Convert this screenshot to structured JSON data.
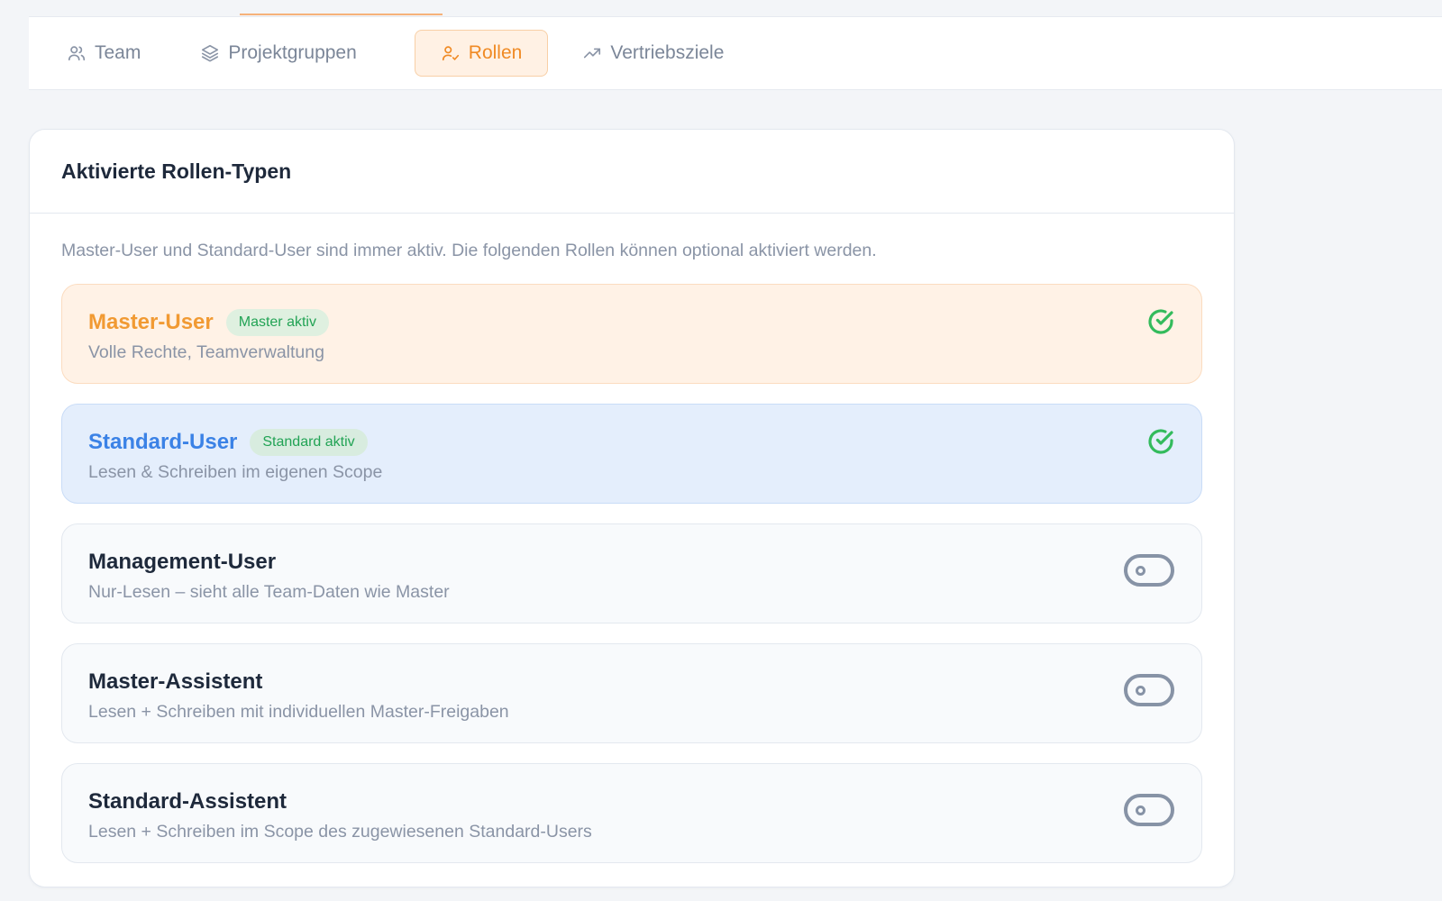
{
  "tabs": [
    {
      "label": "Team",
      "icon": "users-icon",
      "active": false
    },
    {
      "label": "Projektgruppen",
      "icon": "layers-icon",
      "active": false
    },
    {
      "label": "Rollen",
      "icon": "user-check-icon",
      "active": true
    },
    {
      "label": "Vertriebsziele",
      "icon": "trending-up-icon",
      "active": false
    }
  ],
  "card": {
    "title": "Aktivierte Rollen-Typen",
    "description": "Master-User und Standard-User sind immer aktiv. Die folgenden Rollen können optional aktiviert werden."
  },
  "roles": [
    {
      "title": "Master-User",
      "badge": "Master aktiv",
      "description": "Volle Rechte, Teamverwaltung",
      "status": "always-active",
      "icon": "check-circle-icon"
    },
    {
      "title": "Standard-User",
      "badge": "Standard aktiv",
      "description": "Lesen & Schreiben im eigenen Scope",
      "status": "always-active",
      "icon": "check-circle-icon"
    },
    {
      "title": "Management-User",
      "description": "Nur-Lesen – sieht alle Team-Daten wie Master",
      "status": "off",
      "icon": "toggle-off-icon"
    },
    {
      "title": "Master-Assistent",
      "description": "Lesen + Schreiben mit individuellen Master-Freigaben",
      "status": "off",
      "icon": "toggle-off-icon"
    },
    {
      "title": "Standard-Assistent",
      "description": "Lesen + Schreiben im Scope des zugewiesenen Standard-Users",
      "status": "off",
      "icon": "toggle-off-icon"
    }
  ],
  "colors": {
    "accent": "#f08a24",
    "master_bg": "#fff2e6",
    "standard_bg": "#e4eefc",
    "success": "#33bb5c",
    "muted": "#8a94a6"
  }
}
